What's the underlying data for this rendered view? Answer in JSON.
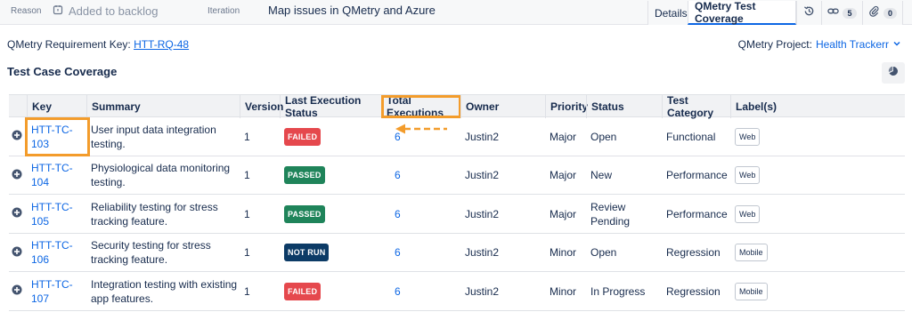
{
  "topbar": {
    "reason_label": "Reason",
    "backlog_text": "Added to backlog",
    "iteration_label": "Iteration",
    "iteration_value": "Map issues in QMetry and Azure",
    "tab_details": "Details",
    "tab_coverage": "QMetry Test Coverage",
    "links_count": "5",
    "attachments_count": "0"
  },
  "requirement": {
    "label": "QMetry Requirement Key:",
    "key": "HTT-RQ-48",
    "project_label": "QMetry Project:",
    "project_value": "Health Trackerr"
  },
  "section_title": "Test Case Coverage",
  "table": {
    "headers": {
      "key": "Key",
      "summary": "Summary",
      "version": "Version",
      "last_status": "Last Execution Status",
      "total_exec": "Total Executions",
      "owner": "Owner",
      "priority": "Priority",
      "status": "Status",
      "category": "Test Category",
      "labels": "Label(s)"
    },
    "rows": [
      {
        "key": "HTT-TC-103",
        "summary": "User input data integration testing.",
        "version": "1",
        "last_status": "FAILED",
        "total": "6",
        "owner": "Justin2",
        "priority": "Major",
        "status": "Open",
        "category": "Functional",
        "label": "Web"
      },
      {
        "key": "HTT-TC-104",
        "summary": "Physiological data monitoring testing.",
        "version": "1",
        "last_status": "PASSED",
        "total": "6",
        "owner": "Justin2",
        "priority": "Major",
        "status": "New",
        "category": "Performance",
        "label": "Web"
      },
      {
        "key": "HTT-TC-105",
        "summary": "Reliability testing for stress tracking feature.",
        "version": "1",
        "last_status": "PASSED",
        "total": "6",
        "owner": "Justin2",
        "priority": "Major",
        "status": "Review Pending",
        "category": "Performance",
        "label": "Web"
      },
      {
        "key": "HTT-TC-106",
        "summary": "Security testing for stress tracking feature.",
        "version": "1",
        "last_status": "NOT RUN",
        "total": "6",
        "owner": "Justin2",
        "priority": "Minor",
        "status": "Open",
        "category": "Regression",
        "label": "Mobile"
      },
      {
        "key": "HTT-TC-107",
        "summary": "Integration testing with existing app features.",
        "version": "1",
        "last_status": "FAILED",
        "total": "6",
        "owner": "Justin2",
        "priority": "Minor",
        "status": "In Progress",
        "category": "Regression",
        "label": "Mobile"
      }
    ]
  },
  "colors": {
    "FAILED": "#e5484d",
    "PASSED": "#1f845a",
    "NOT RUN": "#0c3b66",
    "highlight": "#f39c2b",
    "link": "#0c66e4"
  }
}
